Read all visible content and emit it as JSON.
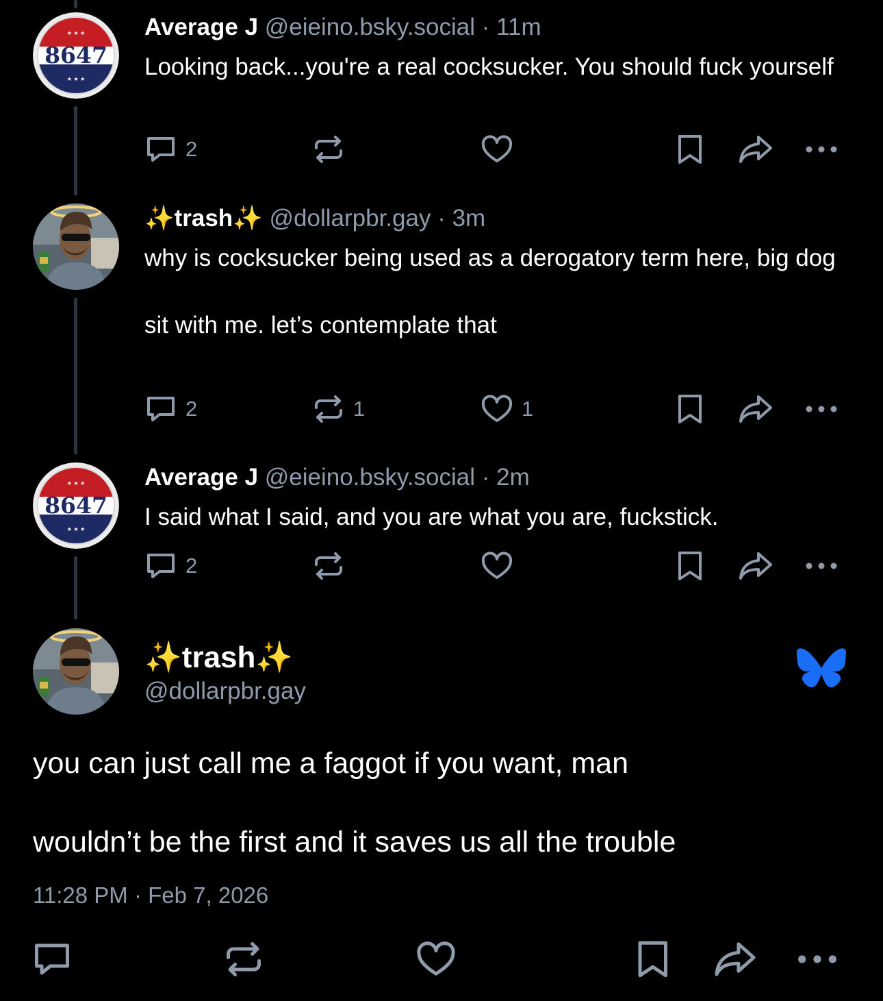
{
  "colors": {
    "background": "#000000",
    "text_primary": "#ffffff",
    "text_secondary": "#8f9bab",
    "thread_line": "#2c3542",
    "bluesky_brand": "#1a6ef5",
    "sparkle": "#ffd84a"
  },
  "replies": [
    {
      "author": "Average J",
      "handle": "@eieino.bsky.social",
      "sep": "·",
      "age": "11m",
      "avatar": "8647-badge",
      "avatar_text": "8647",
      "text": [
        "Looking back...you're a real cocksucker.  You should fuck yourself"
      ],
      "counts": {
        "reply": "2",
        "repost": "",
        "like": ""
      }
    },
    {
      "author": "trash",
      "handle": "@dollarpbr.gay",
      "sep": "·",
      "age": "3m",
      "avatar": "photo-man-sunglasses-halo",
      "text": [
        "why is cocksucker being used as a derogatory term here, big dog",
        "",
        "sit with me. let’s contemplate that"
      ],
      "counts": {
        "reply": "2",
        "repost": "1",
        "like": "1"
      }
    },
    {
      "author": "Average J",
      "handle": "@eieino.bsky.social",
      "sep": "·",
      "age": "2m",
      "avatar": "8647-badge",
      "avatar_text": "8647",
      "text": [
        "I said what I said, and you are what you are, fuckstick."
      ],
      "counts": {
        "reply": "2",
        "repost": "",
        "like": ""
      }
    }
  ],
  "main_post": {
    "author": "trash",
    "sparkle": "✨",
    "handle": "@dollarpbr.gay",
    "avatar": "photo-man-sunglasses-halo",
    "text": [
      "you can just call me a faggot if you want, man",
      "",
      "wouldn’t be the first and it saves us all the trouble"
    ],
    "timestamp": "11:28 PM · Feb 7, 2026",
    "brand_icon": "bluesky-butterfly-icon"
  },
  "icons": {
    "reply": "reply-bubble-icon",
    "repost": "repost-icon",
    "like": "heart-icon",
    "bookmark": "bookmark-icon",
    "share": "share-icon",
    "more": "more-dots-icon"
  }
}
